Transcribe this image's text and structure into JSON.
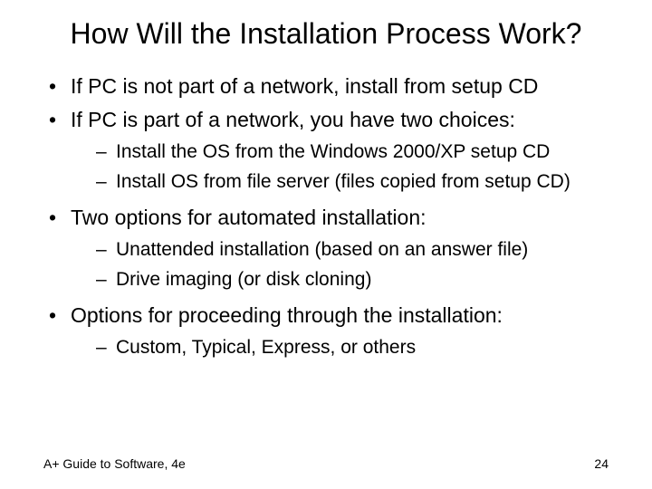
{
  "title": "How Will the Installation Process Work?",
  "bullets": [
    {
      "text": "If PC is not part of a network, install from setup CD",
      "sub": []
    },
    {
      "text": "If PC is part of a network, you have two choices:",
      "sub": [
        "Install the OS from the Windows 2000/XP setup CD",
        "Install OS from file server (files copied from setup CD)"
      ]
    },
    {
      "text": "Two options for automated installation:",
      "sub": [
        "Unattended installation (based on an answer file)",
        "Drive imaging (or disk cloning)"
      ]
    },
    {
      "text": "Options for proceeding through the installation:",
      "sub": [
        "Custom, Typical, Express, or others"
      ]
    }
  ],
  "footer_left": "A+ Guide to Software, 4e",
  "footer_right": "24"
}
